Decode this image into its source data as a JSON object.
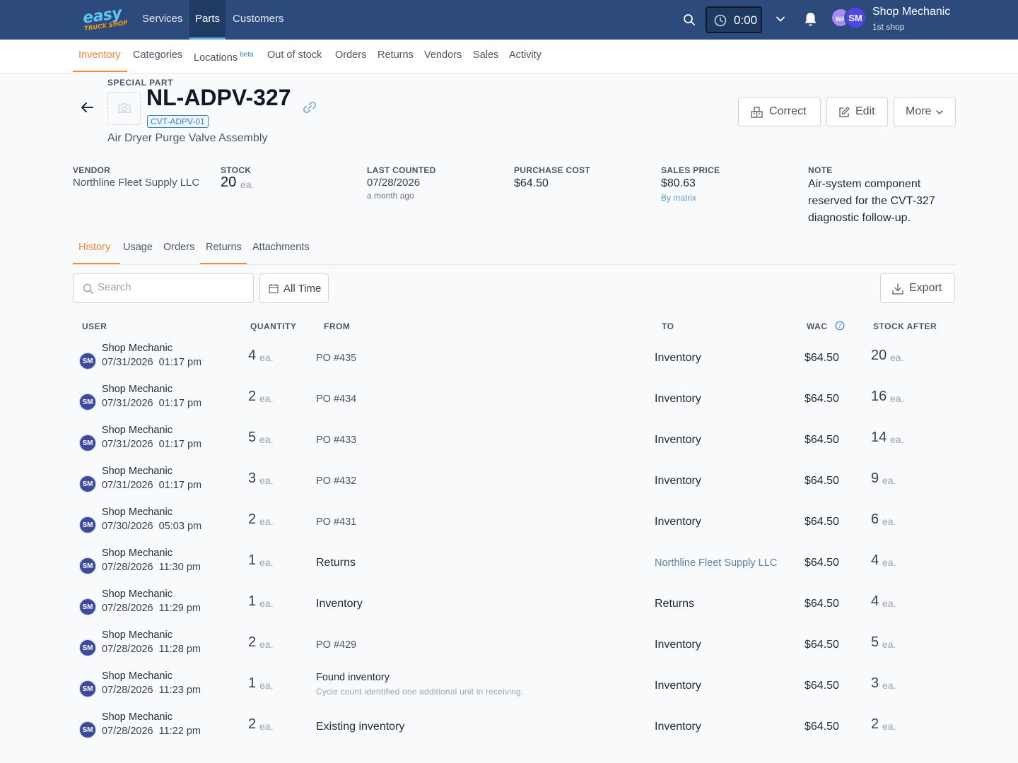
{
  "topbar": {
    "logo_main": "easy",
    "logo_sub": "TRUCK SHOP",
    "nav": [
      "Services",
      "Parts",
      "Customers"
    ],
    "timer": "0:00",
    "avatar_secondary": "WA",
    "avatar_primary": "SM",
    "user_name": "Shop Mechanic",
    "user_shop": "1st shop"
  },
  "subnav": {
    "items": [
      "Inventory",
      "Categories",
      "Locations",
      "Out of stock",
      "Orders",
      "Returns",
      "Vendors",
      "Sales",
      "Activity"
    ],
    "beta": "beta"
  },
  "part": {
    "kind": "SPECIAL PART",
    "number": "NL-ADPV-327",
    "alt_code": "CVT-ADPV-01",
    "description": "Air Dryer Purge Valve Assembly"
  },
  "actions": {
    "correct": "Correct",
    "edit": "Edit",
    "more": "More"
  },
  "info": {
    "vendor_label": "VENDOR",
    "vendor": "Northline Fleet Supply LLC",
    "stock_label": "STOCK",
    "stock": "20",
    "stock_unit": "ea.",
    "last_counted_label": "LAST COUNTED",
    "last_counted": "07/28/2026",
    "last_counted_rel": "a month ago",
    "purchase_cost_label": "PURCHASE COST",
    "purchase_cost": "$64.50",
    "sales_price_label": "SALES PRICE",
    "sales_price": "$80.63",
    "sales_price_note": "By matrix",
    "note_label": "NOTE",
    "note": "Air-system component reserved for the CVT-327 diagnostic follow-up."
  },
  "tabs": [
    "History",
    "Usage",
    "Orders",
    "Returns",
    "Attachments"
  ],
  "filters": {
    "search_placeholder": "Search",
    "date_range": "All Time",
    "export": "Export"
  },
  "table": {
    "headers": {
      "user": "USER",
      "quantity": "QUANTITY",
      "from": "FROM",
      "to": "TO",
      "wac": "WAC",
      "stock_after": "STOCK AFTER"
    },
    "rows": [
      {
        "initials": "SM",
        "user": "Shop Mechanic",
        "date": "07/31/2026  01:17 pm",
        "qty": "4",
        "unit": "ea.",
        "from": "PO #435",
        "from_note": "",
        "to": "Inventory",
        "wac": "$64.50",
        "stock_after": "20"
      },
      {
        "initials": "SM",
        "user": "Shop Mechanic",
        "date": "07/31/2026  01:17 pm",
        "qty": "2",
        "unit": "ea.",
        "from": "PO #434",
        "from_note": "",
        "to": "Inventory",
        "wac": "$64.50",
        "stock_after": "16"
      },
      {
        "initials": "SM",
        "user": "Shop Mechanic",
        "date": "07/31/2026  01:17 pm",
        "qty": "5",
        "unit": "ea.",
        "from": "PO #433",
        "from_note": "",
        "to": "Inventory",
        "wac": "$64.50",
        "stock_after": "14"
      },
      {
        "initials": "SM",
        "user": "Shop Mechanic",
        "date": "07/31/2026  01:17 pm",
        "qty": "3",
        "unit": "ea.",
        "from": "PO #432",
        "from_note": "",
        "to": "Inventory",
        "wac": "$64.50",
        "stock_after": "9"
      },
      {
        "initials": "SM",
        "user": "Shop Mechanic",
        "date": "07/30/2026  05:03 pm",
        "qty": "2",
        "unit": "ea.",
        "from": "PO #431",
        "from_note": "",
        "to": "Inventory",
        "wac": "$64.50",
        "stock_after": "6"
      },
      {
        "initials": "SM",
        "user": "Shop Mechanic",
        "date": "07/28/2026  11:30 pm",
        "qty": "1",
        "unit": "ea.",
        "from": "Returns",
        "from_note": "",
        "to": "Northline Fleet Supply LLC",
        "wac": "$64.50",
        "stock_after": "4"
      },
      {
        "initials": "SM",
        "user": "Shop Mechanic",
        "date": "07/28/2026  11:29 pm",
        "qty": "1",
        "unit": "ea.",
        "from": "Inventory",
        "from_note": "",
        "to": "Returns",
        "wac": "$64.50",
        "stock_after": "4"
      },
      {
        "initials": "SM",
        "user": "Shop Mechanic",
        "date": "07/28/2026  11:28 pm",
        "qty": "2",
        "unit": "ea.",
        "from": "PO #429",
        "from_note": "",
        "to": "Inventory",
        "wac": "$64.50",
        "stock_after": "5"
      },
      {
        "initials": "SM",
        "user": "Shop Mechanic",
        "date": "07/28/2026  11:23 pm",
        "qty": "1",
        "unit": "ea.",
        "from": "Found inventory",
        "from_note": "Cycle count identified one additional unit in receiving.",
        "to": "Inventory",
        "wac": "$64.50",
        "stock_after": "3"
      },
      {
        "initials": "SM",
        "user": "Shop Mechanic",
        "date": "07/28/2026  11:22 pm",
        "qty": "2",
        "unit": "ea.",
        "from": "Existing inventory",
        "from_note": "",
        "to": "Inventory",
        "wac": "$64.50",
        "stock_after": "2"
      }
    ]
  }
}
